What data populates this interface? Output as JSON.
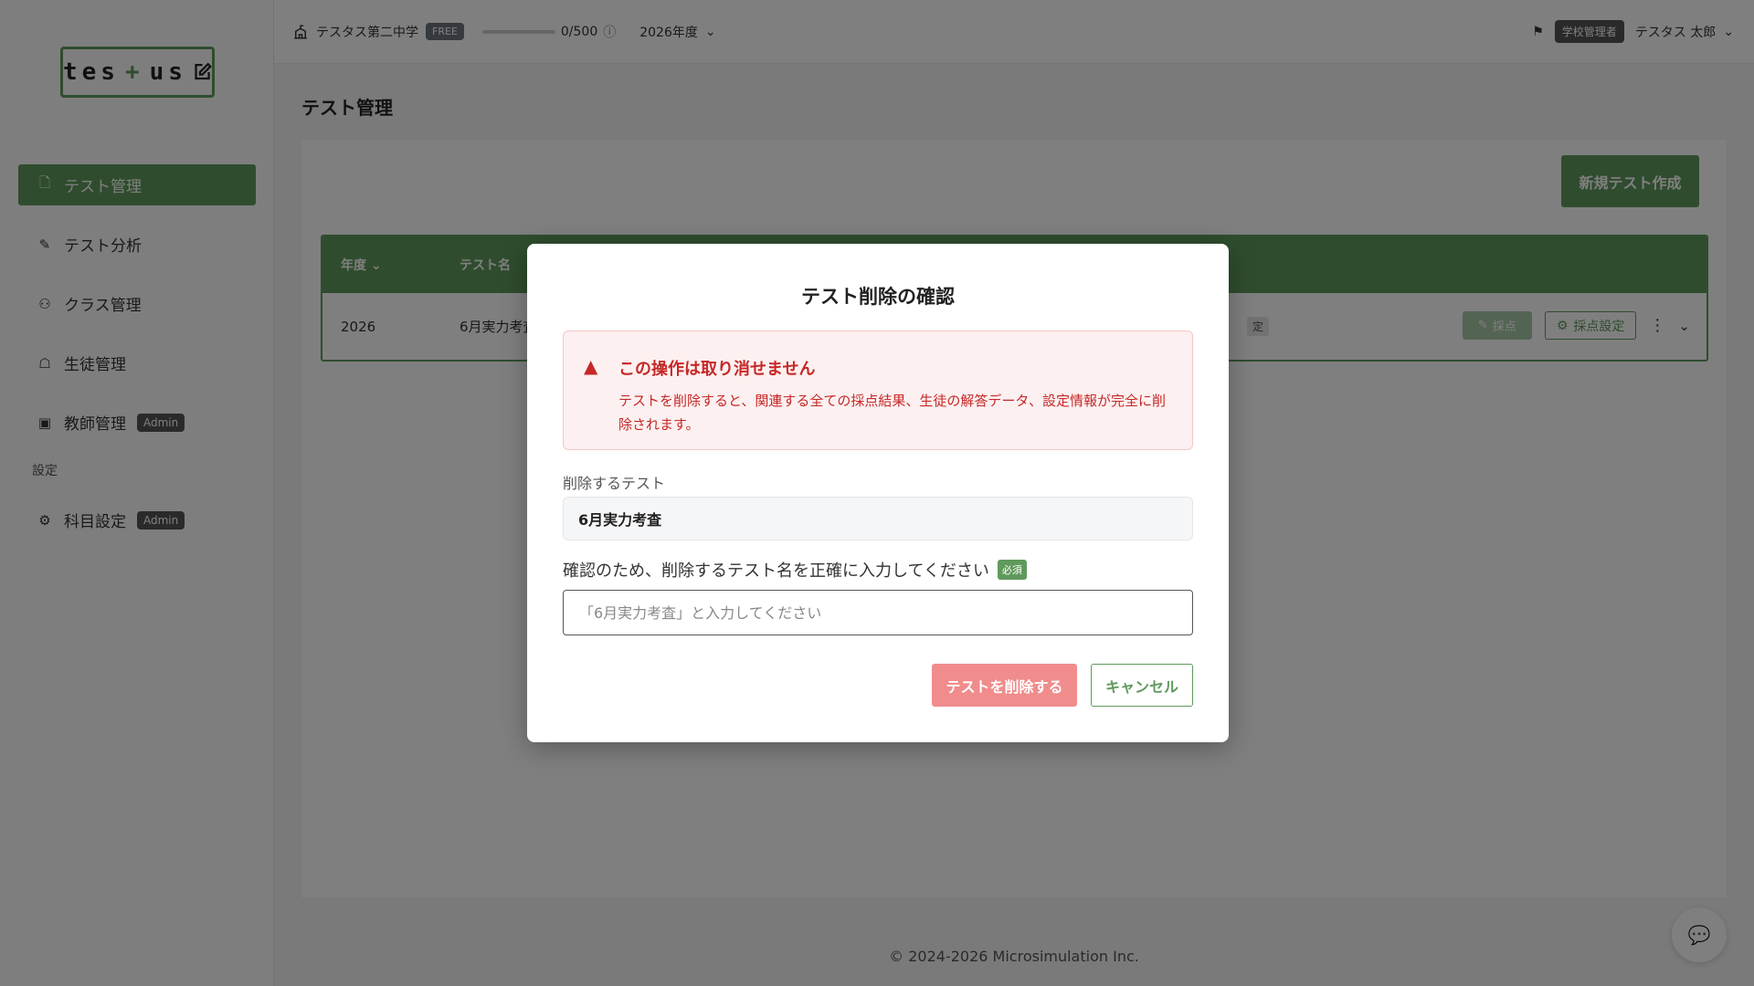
{
  "logo": {
    "text_a": "tes",
    "text_plus": "+",
    "text_b": "us"
  },
  "sidebar": {
    "items": [
      {
        "label": "テスト管理",
        "icon": "document-icon",
        "active": true
      },
      {
        "label": "テスト分析",
        "icon": "analysis-icon"
      },
      {
        "label": "クラス管理",
        "icon": "class-group-icon"
      },
      {
        "label": "生徒管理",
        "icon": "student-cap-icon"
      },
      {
        "label": "教師管理",
        "icon": "teacher-icon",
        "badge": "Admin"
      }
    ],
    "section_label": "設定",
    "settings_items": [
      {
        "label": "科目設定",
        "icon": "gear-icon",
        "badge": "Admin"
      }
    ]
  },
  "topbar": {
    "school_name": "テスタス第二中学",
    "plan_badge": "FREE",
    "usage": "0/500",
    "usage_fraction": 0,
    "year": "2026年度",
    "role_badge": "学校管理者",
    "user_name": "テスタス 太郎"
  },
  "page": {
    "title": "テスト管理",
    "new_test_button": "新規テスト作成",
    "table": {
      "headers": [
        "年度",
        "テスト名"
      ],
      "rows": [
        {
          "year": "2026",
          "name": "6月実力考査",
          "status_fragment": "定",
          "score_button": "採点",
          "score_settings_button": "採点設定"
        }
      ]
    },
    "footer": "© 2024-2026 Microsimulation Inc."
  },
  "modal": {
    "title": "テスト削除の確認",
    "warning_title": "この操作は取り消せません",
    "warning_text": "テストを削除すると、関連する全ての採点結果、生徒の解答データ、設定情報が完全に削除されます。",
    "delete_target_label": "削除するテスト",
    "delete_target_name": "6月実力考査",
    "confirm_label": "確認のため、削除するテスト名を正確に入力してください",
    "required_badge": "必須",
    "confirm_placeholder": "「6月実力考査」と入力してください",
    "confirm_value": "",
    "delete_button": "テストを削除する",
    "cancel_button": "キャンセル"
  },
  "colors": {
    "brand": "#5f9a5c",
    "danger": "#c62828",
    "delete_button": "#f08c8c"
  }
}
